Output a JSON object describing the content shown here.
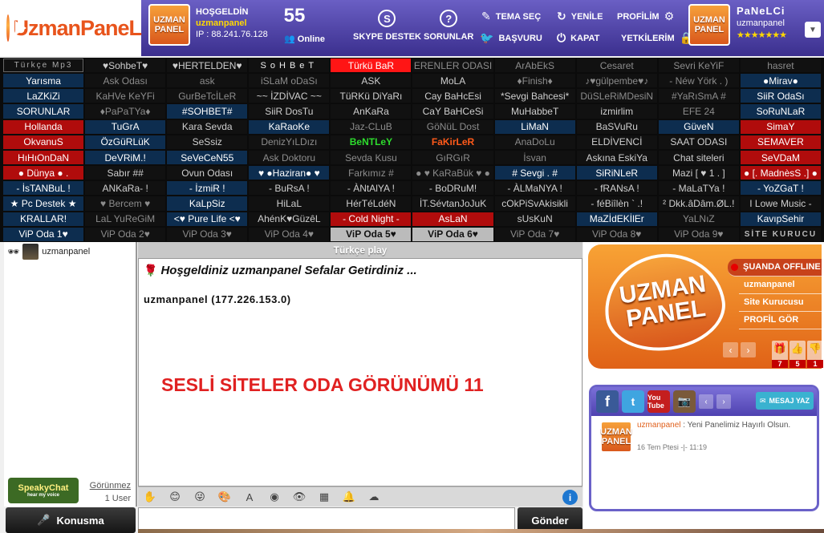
{
  "header": {
    "logo_text": "UzmanPaneL",
    "avatar_line1": "UZMAN",
    "avatar_line2": "PANEL",
    "welcome_title": "HOŞGELDİN",
    "welcome_user": "uzmanpanel",
    "welcome_ip": "IP : 88.241.76.128",
    "online_count": "55",
    "online_label": "Online",
    "skype_label": "SKYPE DESTEK",
    "problems_label": "SORUNLAR",
    "theme_label": "TEMA SEÇ",
    "applications_label": "BAŞVURU",
    "refresh_label": "YENİLE",
    "close_label": "KAPAT",
    "profile_label": "PROFİLİM",
    "permissions_label": "YETKİLERİM",
    "panel_name": "PaNeLCi",
    "panel_user": "uzmanpanel",
    "panel_stars": "★★★★★★★"
  },
  "rooms": [
    {
      "label": "Türkçe Mp3",
      "style": "c-mp3"
    },
    {
      "label": "♥SohbeT♥",
      "style": "c-black"
    },
    {
      "label": "♥HERTELDEN♥",
      "style": "c-black"
    },
    {
      "label": "SoHBeT",
      "style": "c-sohbet"
    },
    {
      "label": "Türkü BaR",
      "style": "c-brightred"
    },
    {
      "label": "ERENLER ODASI",
      "style": "c-dim"
    },
    {
      "label": "ArAbEkS",
      "style": "c-dim"
    },
    {
      "label": "Cesaret",
      "style": "c-dim"
    },
    {
      "label": "Sevri KeYiF",
      "style": "c-dim"
    },
    {
      "label": "hasret",
      "style": "c-dim"
    },
    {
      "label": "Yarısma",
      "style": "c-blue"
    },
    {
      "label": "Ask Odası",
      "style": "c-dim"
    },
    {
      "label": "ask",
      "style": "c-dim"
    },
    {
      "label": "iSLaM oDaSı",
      "style": "c-dim"
    },
    {
      "label": "ASK",
      "style": "c-black"
    },
    {
      "label": "MoLA",
      "style": "c-black"
    },
    {
      "label": "♦Finish♦",
      "style": "c-dim"
    },
    {
      "label": "♪♥gülpembe♥♪",
      "style": "c-dim"
    },
    {
      "label": "- Néw Yörk . )",
      "style": "c-dim"
    },
    {
      "label": "●Mirav●",
      "style": "c-blue"
    },
    {
      "label": "LaZKiZi",
      "style": "c-blue"
    },
    {
      "label": "KaHVe KeYFi",
      "style": "c-dim"
    },
    {
      "label": "GurBeTcİLeR",
      "style": "c-dim"
    },
    {
      "label": "~~ İZDİVAC ~~",
      "style": "c-black"
    },
    {
      "label": "TüRKü DiYaRı",
      "style": "c-black"
    },
    {
      "label": "Cay BaHcEsi",
      "style": "c-black"
    },
    {
      "label": "*Sevgi Bahcesi*",
      "style": "c-black"
    },
    {
      "label": "DüSLeRiMDesiN",
      "style": "c-dim"
    },
    {
      "label": "#YaRıSmA #",
      "style": "c-dim"
    },
    {
      "label": "SiiR OdaSı",
      "style": "c-blue"
    },
    {
      "label": "SORUNLAR",
      "style": "c-blue"
    },
    {
      "label": "♦PaPaTYa♦",
      "style": "c-dim"
    },
    {
      "label": "#SOHBET#",
      "style": "c-blue"
    },
    {
      "label": "SiiR DosTu",
      "style": "c-black"
    },
    {
      "label": "AnKaRa",
      "style": "c-black"
    },
    {
      "label": "CaY BaHCeSi",
      "style": "c-black"
    },
    {
      "label": "MuHabbeT",
      "style": "c-black"
    },
    {
      "label": "izmirlim",
      "style": "c-black"
    },
    {
      "label": "EFE 24",
      "style": "c-dim"
    },
    {
      "label": "SoRuNLaR",
      "style": "c-blue"
    },
    {
      "label": "Hollanda",
      "style": "c-red"
    },
    {
      "label": "TuGrA",
      "style": "c-blue"
    },
    {
      "label": "Kara Sevda",
      "style": "c-black"
    },
    {
      "label": "KaRaoKe",
      "style": "c-blue"
    },
    {
      "label": "Jaz-CLuB",
      "style": "c-dim"
    },
    {
      "label": "GöNüL Dost",
      "style": "c-dim"
    },
    {
      "label": "LiMaN",
      "style": "c-blue"
    },
    {
      "label": "BaSVuRu",
      "style": "c-black"
    },
    {
      "label": "GüveN",
      "style": "c-blue"
    },
    {
      "label": "SimaY",
      "style": "c-red"
    },
    {
      "label": "OkvanuS",
      "style": "c-red"
    },
    {
      "label": "ÖzGüRLüK",
      "style": "c-blue"
    },
    {
      "label": "SeSsiz",
      "style": "c-black"
    },
    {
      "label": "DenizYıLDızı",
      "style": "c-dim"
    },
    {
      "label": "BeNTLeY",
      "style": "c-green"
    },
    {
      "label": "FaKirLeR",
      "style": "c-orange"
    },
    {
      "label": "AnaDoLu",
      "style": "c-dim"
    },
    {
      "label": "ELDİVENCİ",
      "style": "c-black"
    },
    {
      "label": "SAAT ODASI",
      "style": "c-black"
    },
    {
      "label": "SEMAVER",
      "style": "c-red"
    },
    {
      "label": "HıHıOnDaN",
      "style": "c-red"
    },
    {
      "label": "DeVRiM.!",
      "style": "c-blue"
    },
    {
      "label": "SeVeCeN55",
      "style": "c-blue"
    },
    {
      "label": "Ask Doktoru",
      "style": "c-dim"
    },
    {
      "label": "Sevda Kusu",
      "style": "c-dim"
    },
    {
      "label": "GıRGıR",
      "style": "c-dim"
    },
    {
      "label": "İsvan",
      "style": "c-dim"
    },
    {
      "label": "Askına EskiYa",
      "style": "c-black"
    },
    {
      "label": "Chat siteleri",
      "style": "c-black"
    },
    {
      "label": "SeVDaM",
      "style": "c-red"
    },
    {
      "label": "● Dünya ● .",
      "style": "c-red"
    },
    {
      "label": "Sabır ##",
      "style": "c-black"
    },
    {
      "label": "Ovun Odası",
      "style": "c-black"
    },
    {
      "label": "♥ ●Haziran● ♥",
      "style": "c-blue"
    },
    {
      "label": "Farkımız #",
      "style": "c-dim"
    },
    {
      "label": "● ♥ KaRaBük ♥ ●",
      "style": "c-dim"
    },
    {
      "label": "# Sevgi . #",
      "style": "c-blue"
    },
    {
      "label": "SiRiNLeR",
      "style": "c-blue"
    },
    {
      "label": "Mazi [ ♥ 1 . ]",
      "style": "c-black"
    },
    {
      "label": "● [. MadnèsS .] ●",
      "style": "c-red"
    },
    {
      "label": "- İsTANBuL !",
      "style": "c-blue"
    },
    {
      "label": "ANKaRa- !",
      "style": "c-black"
    },
    {
      "label": "- İzmiR !",
      "style": "c-blue"
    },
    {
      "label": "- BuRsA !",
      "style": "c-black"
    },
    {
      "label": "- ÀNtAlYA !",
      "style": "c-black"
    },
    {
      "label": "- BoDRuM!",
      "style": "c-black"
    },
    {
      "label": "- ÀLMaNYA !",
      "style": "c-black"
    },
    {
      "label": "- fRANsA !",
      "style": "c-black"
    },
    {
      "label": "- MaLaTYa !",
      "style": "c-black"
    },
    {
      "label": "- YoZGaT !",
      "style": "c-blue"
    },
    {
      "label": "★ Pc Destek ★",
      "style": "c-blue"
    },
    {
      "label": "♥ Bercem ♥",
      "style": "c-dim"
    },
    {
      "label": "KaLpSiz",
      "style": "c-blue"
    },
    {
      "label": "HiLaL",
      "style": "c-black"
    },
    {
      "label": "HérTéLdéN",
      "style": "c-black"
    },
    {
      "label": "İT.SévtanJoJuK",
      "style": "c-black"
    },
    {
      "label": "cOkPiSvAkisikli",
      "style": "c-black"
    },
    {
      "label": "- féBiîlèn ` .!",
      "style": "c-black"
    },
    {
      "label": "² Dkk.âDâm.ØL.!",
      "style": "c-black"
    },
    {
      "label": "I Lowe Music -",
      "style": "c-black"
    },
    {
      "label": "KRALLAR!",
      "style": "c-blue"
    },
    {
      "label": "LaL YuReGiM",
      "style": "c-dim"
    },
    {
      "label": "<♥ Pure Life <♥",
      "style": "c-blue"
    },
    {
      "label": "AhénK♥GüzêL",
      "style": "c-black"
    },
    {
      "label": "- Cold Night -",
      "style": "c-red"
    },
    {
      "label": "AsLaN",
      "style": "c-red"
    },
    {
      "label": "sUsKuN",
      "style": "c-black"
    },
    {
      "label": "MaZİdEKİlEr",
      "style": "c-blue"
    },
    {
      "label": "YaLNıZ",
      "style": "c-dim"
    },
    {
      "label": "KavıpSehir",
      "style": "c-blue"
    },
    {
      "label": "ViP Oda 1♥",
      "style": "c-blue"
    },
    {
      "label": "ViP Oda 2♥",
      "style": "c-dim"
    },
    {
      "label": "ViP Oda 3♥",
      "style": "c-dim"
    },
    {
      "label": "ViP Oda 4♥",
      "style": "c-dim"
    },
    {
      "label": "ViP Oda 5♥",
      "style": "c-gray"
    },
    {
      "label": "ViP Oda 6♥",
      "style": "c-gray"
    },
    {
      "label": "ViP Oda 7♥",
      "style": "c-dim"
    },
    {
      "label": "ViP Oda 8♥",
      "style": "c-dim"
    },
    {
      "label": "ViP Oda 9♥",
      "style": "c-dim"
    },
    {
      "label": "SİTE KURUCU",
      "style": "c-kurucu"
    }
  ],
  "userlist": {
    "user": "uzmanpanel",
    "speaky_title": "SpeakyChat",
    "speaky_tagline": "hear my voice",
    "invisible_link": "Görünmez",
    "user_count": "1 User",
    "talk_button": "Konusma"
  },
  "chat": {
    "room_title": "Türkçe play",
    "welcome_message": "Hoşgeldiniz uzmanpanel Sefalar Getirdiniz ...",
    "join_message": "uzmanpanel (177.226.153.0)",
    "overlay_title": "SESLİ SİTELER ODA GÖRÜNÜMÜ 11",
    "send_button": "Gönder",
    "info_glyph": "i"
  },
  "profile": {
    "avatar_line1": "UZMAN",
    "avatar_line2": "PANEL",
    "status_offline": "ŞUANDA OFFLINE",
    "username": "uzmanpanel",
    "role": "Site Kurucusu",
    "view_profile": "PROFİL GÖR",
    "vote_gifts": "7",
    "vote_likes": "5",
    "vote_dislikes": "1"
  },
  "social": {
    "youtube_label": "You Tube",
    "message_button": "MESAJ YAZ",
    "post_user": "uzmanpanel",
    "post_text": " : Yeni Panelimiz Hayırlı Olsun.",
    "post_date": "16 Tem Ptesi -|- 11:19",
    "post_avatar_line1": "UZMAN",
    "post_avatar_line2": "PANEL"
  }
}
